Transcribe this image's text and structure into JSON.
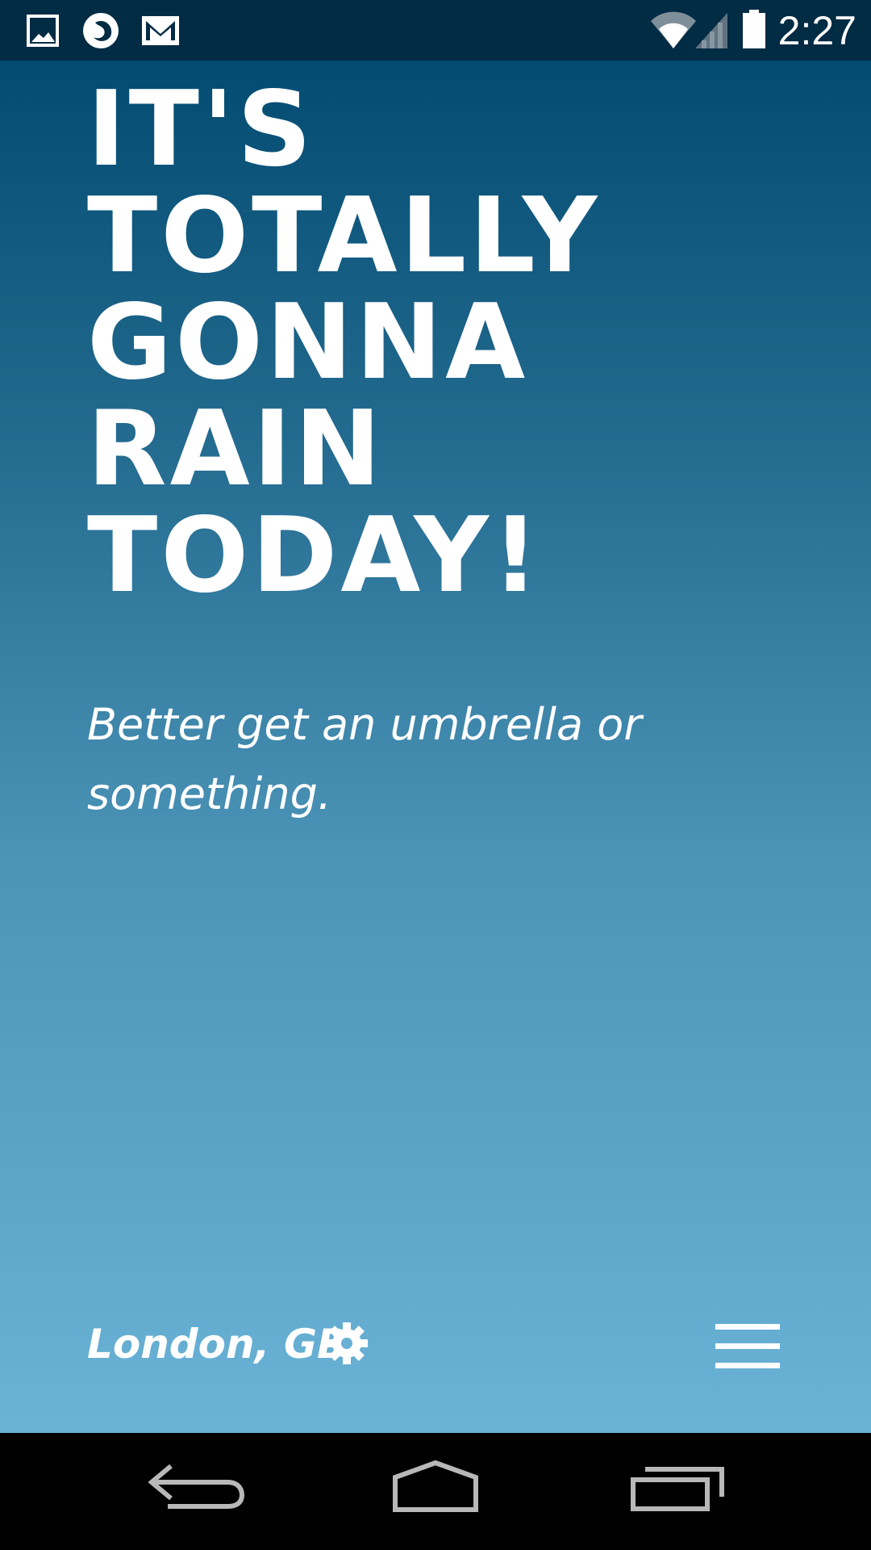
{
  "status_bar": {
    "time": "2:27",
    "left_icons": [
      "image-notification-icon",
      "firefox-icon",
      "gmail-icon"
    ],
    "right_icons": [
      "wifi-icon",
      "cell-signal-icon",
      "battery-icon"
    ]
  },
  "weather": {
    "headline_lines": [
      "IT'S",
      "TOTALLY",
      "GONNA",
      "RAIN",
      "TODAY!"
    ],
    "subtext": "Better get an umbrella or something.",
    "location": "London, GB"
  },
  "colors": {
    "status_bar_bg": "#022b44",
    "gradient_top": "#034b71",
    "gradient_bottom": "#6ab3d7",
    "text": "#ffffff",
    "nav_bar_bg": "#000000"
  },
  "nav_bar": {
    "buttons": [
      "back-icon",
      "home-icon",
      "recent-apps-icon"
    ]
  }
}
